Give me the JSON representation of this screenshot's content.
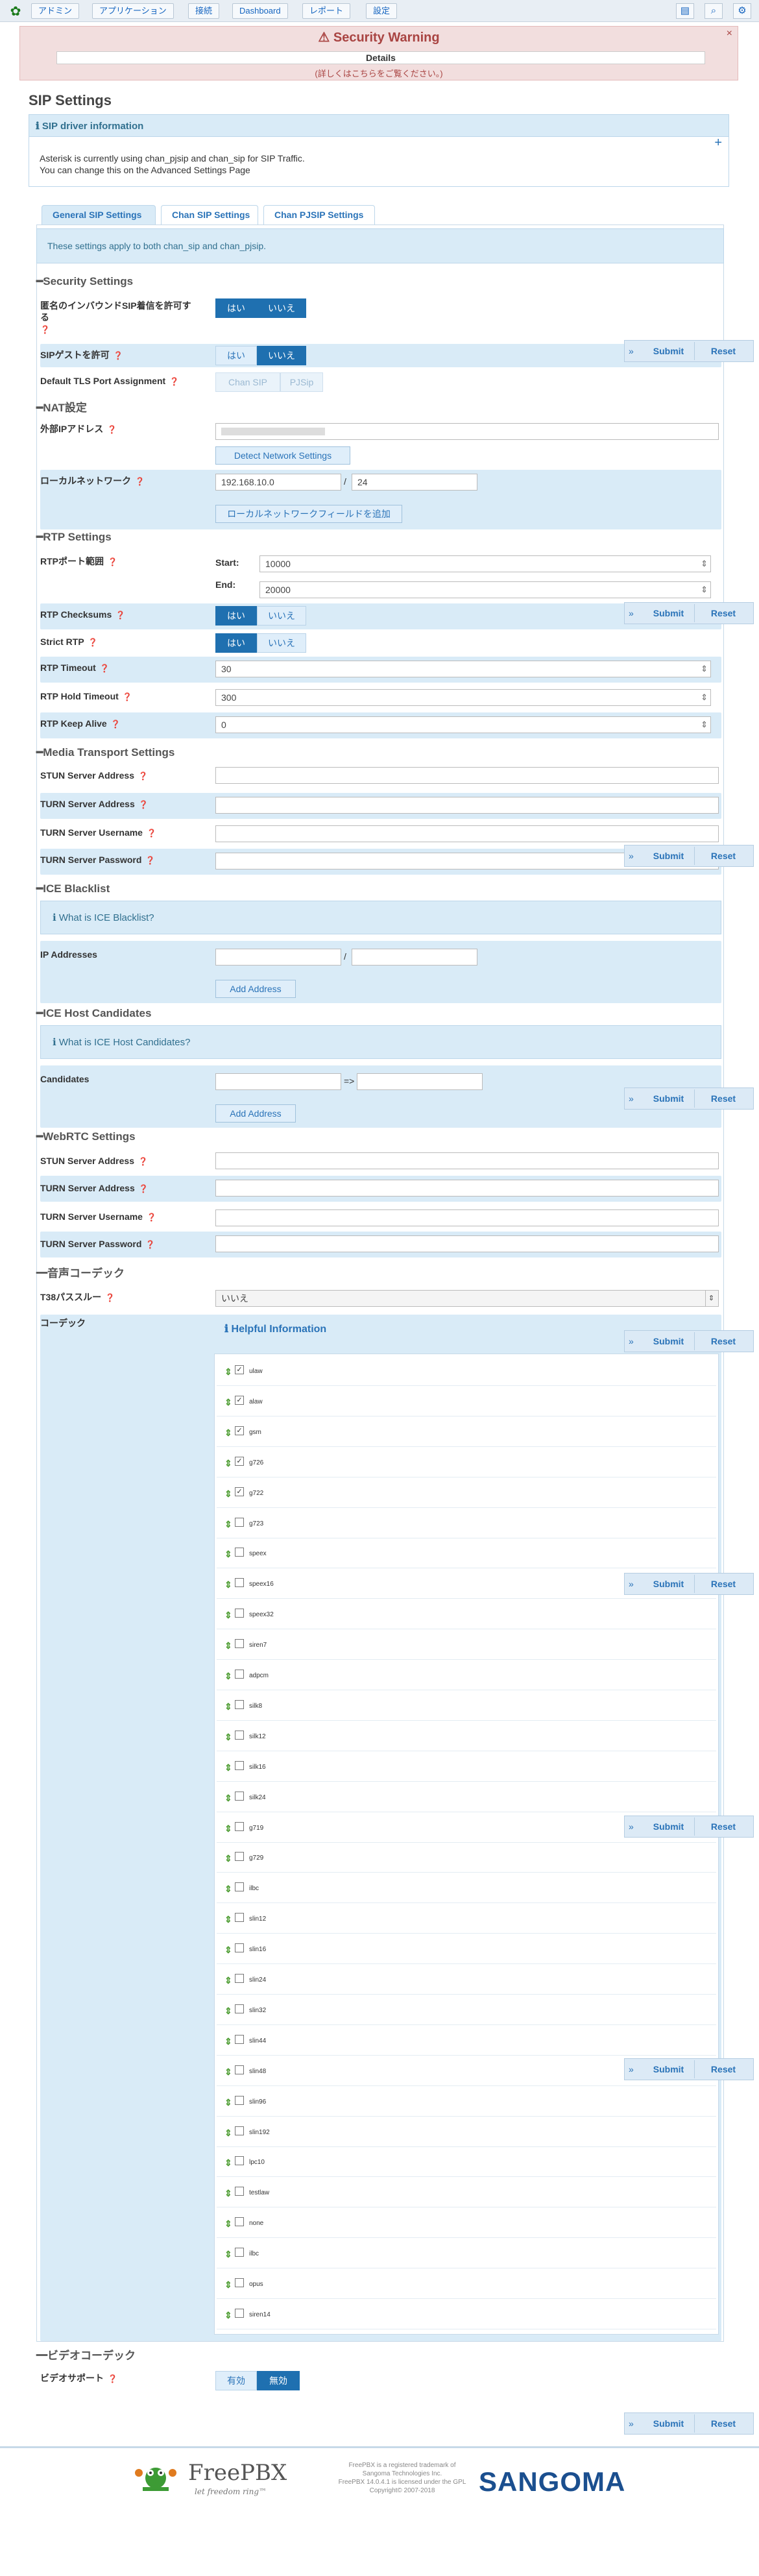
{
  "topbar": {
    "menu": [
      "アドミン",
      "アプリケーション",
      "接続",
      "Dashboard",
      "レポート",
      "設定"
    ],
    "icons": [
      "id-card-icon",
      "search-icon",
      "gear-icon"
    ]
  },
  "warning": {
    "title": "Security Warning",
    "details": "Details",
    "sub": "(詳しくはこちらをご覧ください。)"
  },
  "page": {
    "title": "SIP Settings"
  },
  "driver": {
    "title": "SIP driver information",
    "line1": "Asterisk is currently using chan_pjsip and chan_sip for SIP Traffic.",
    "line2": "You can change this on the Advanced Settings Page"
  },
  "tabs": [
    "General SIP Settings",
    "Chan SIP Settings",
    "Chan PJSIP Settings"
  ],
  "banner": "These settings apply to both chan_sip and chan_pjsip.",
  "float": {
    "submit": "Submit",
    "reset": "Reset"
  },
  "security": {
    "title": "Security Settings",
    "anon_label": "匿名のインバウンドSIP着信を許可する",
    "guest_label": "SIPゲストを許可",
    "tls_label": "Default TLS Port Assignment",
    "yes": "はい",
    "no": "いいえ",
    "chan_sip": "Chan SIP",
    "pjsip": "PJSip"
  },
  "nat": {
    "title": "NAT設定",
    "external_label": "外部IPアドレス",
    "detect_btn": "Detect Network Settings",
    "local_label": "ローカルネットワーク",
    "local_ip": "192.168.10.0",
    "local_mask": "24",
    "slash": "/",
    "add_local_btn": "ローカルネットワークフィールドを追加"
  },
  "rtp": {
    "title": "RTP Settings",
    "port_label": "RTPポート範囲",
    "start_label": "Start:",
    "start": "10000",
    "end_label": "End:",
    "end": "20000",
    "checksums_label": "RTP Checksums",
    "strict_label": "Strict RTP",
    "timeout_label": "RTP Timeout",
    "timeout": "30",
    "hold_label": "RTP Hold Timeout",
    "hold": "300",
    "keepalive_label": "RTP Keep Alive",
    "keepalive": "0"
  },
  "media": {
    "title": "Media Transport Settings",
    "stun": "STUN Server Address",
    "turn": "TURN Server Address",
    "turn_user": "TURN Server Username",
    "turn_pass": "TURN Server Password"
  },
  "ice_blacklist": {
    "title": "ICE Blacklist",
    "info": "What is ICE Blacklist?",
    "ip_label": "IP Addresses",
    "slash": "/",
    "add": "Add Address"
  },
  "ice_host": {
    "title": "ICE Host Candidates",
    "info": "What is ICE Host Candidates?",
    "cand_label": "Candidates",
    "arrow": "=>",
    "add": "Add Address"
  },
  "webrtc": {
    "title": "WebRTC Settings",
    "stun": "STUN Server Address",
    "turn": "TURN Server Address",
    "turn_user": "TURN Server Username",
    "turn_pass": "TURN Server Password"
  },
  "audio": {
    "title": "音声コーデック",
    "t38_label": "T38パススルー",
    "t38_value": "いいえ",
    "codec_label": "コーデック",
    "helpful": "Helpful Information",
    "codecs": [
      {
        "name": "ulaw",
        "checked": true
      },
      {
        "name": "alaw",
        "checked": true
      },
      {
        "name": "gsm",
        "checked": true
      },
      {
        "name": "g726",
        "checked": true
      },
      {
        "name": "g722",
        "checked": true
      },
      {
        "name": "g723",
        "checked": false
      },
      {
        "name": "speex",
        "checked": false
      },
      {
        "name": "speex16",
        "checked": false
      },
      {
        "name": "speex32",
        "checked": false
      },
      {
        "name": "siren7",
        "checked": false
      },
      {
        "name": "adpcm",
        "checked": false
      },
      {
        "name": "silk8",
        "checked": false
      },
      {
        "name": "silk12",
        "checked": false
      },
      {
        "name": "silk16",
        "checked": false
      },
      {
        "name": "silk24",
        "checked": false
      },
      {
        "name": "g719",
        "checked": false
      },
      {
        "name": "g729",
        "checked": false
      },
      {
        "name": "ilbc",
        "checked": false
      },
      {
        "name": "slin12",
        "checked": false
      },
      {
        "name": "slin16",
        "checked": false
      },
      {
        "name": "slin24",
        "checked": false
      },
      {
        "name": "slin32",
        "checked": false
      },
      {
        "name": "slin44",
        "checked": false
      },
      {
        "name": "slin48",
        "checked": false
      },
      {
        "name": "slin96",
        "checked": false
      },
      {
        "name": "slin192",
        "checked": false
      },
      {
        "name": "lpc10",
        "checked": false
      },
      {
        "name": "testlaw",
        "checked": false
      },
      {
        "name": "none",
        "checked": false
      },
      {
        "name": "ilbc",
        "checked": false
      },
      {
        "name": "opus",
        "checked": false
      },
      {
        "name": "siren14",
        "checked": false
      }
    ]
  },
  "video": {
    "title": "ビデオコーデック",
    "support_label": "ビデオサポート",
    "enabled": "有効",
    "disabled": "無効"
  },
  "footer": {
    "brand": "FreePBX",
    "tagline": "let freedom ring™",
    "legal1": "FreePBX is a registered trademark of",
    "legal2": "Sangoma Technologies Inc.",
    "legal3": "FreePBX 14.0.4.1 is licensed under the GPL",
    "legal4": "Copyright© 2007-2018",
    "sangoma": "SANGOMA"
  }
}
